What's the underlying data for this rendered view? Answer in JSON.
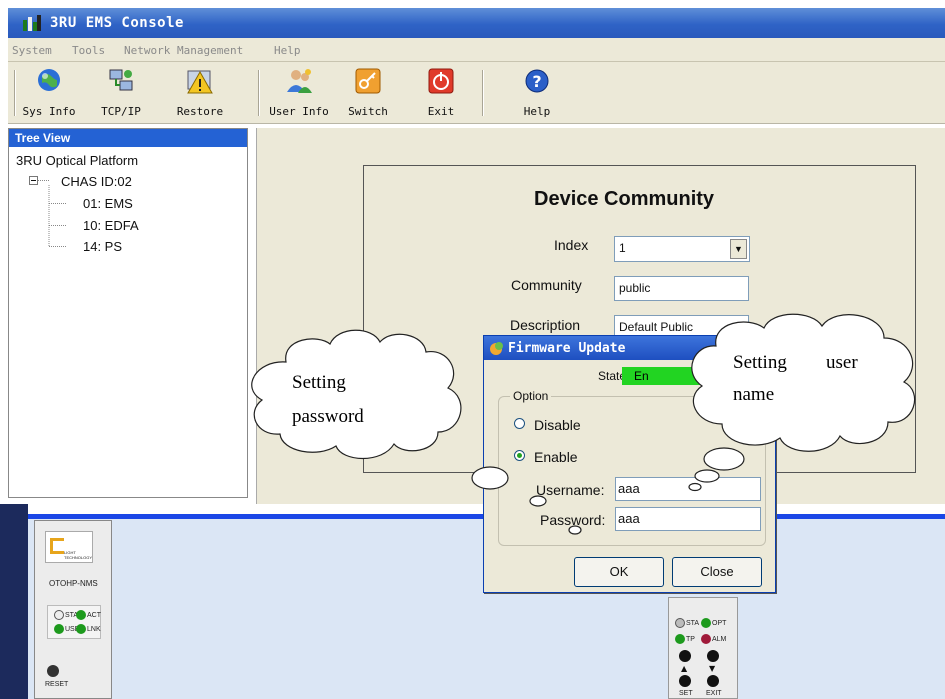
{
  "window": {
    "title": "3RU EMS Console"
  },
  "menu": [
    "System",
    "Tools",
    "Network Management",
    "Help"
  ],
  "toolbar": [
    {
      "label": "Sys Info",
      "icon": "globe-icon"
    },
    {
      "label": "TCP/IP",
      "icon": "network-icon"
    },
    {
      "label": "Restore",
      "icon": "warning-icon"
    },
    {
      "label": "User Info",
      "icon": "users-icon"
    },
    {
      "label": "Switch",
      "icon": "key-icon"
    },
    {
      "label": "Exit",
      "icon": "power-icon"
    },
    {
      "label": "Help",
      "icon": "help-icon"
    }
  ],
  "tree": {
    "header": "Tree View",
    "root": "3RU Optical Platform",
    "chassis": "CHAS ID:02",
    "items": [
      "01: EMS",
      "10: EDFA",
      "14: PS"
    ]
  },
  "community": {
    "title": "Device Community",
    "index_label": "Index",
    "index_value": "1",
    "community_label": "Community",
    "community_value": "public",
    "description_label": "Description",
    "description_value": "Default Public"
  },
  "dialog": {
    "title": "Firmware Update",
    "state_label": "State",
    "state_value": "En",
    "option_label": "Option",
    "disable_label": "Disable",
    "enable_label": "Enable",
    "username_label": "Username:",
    "username_value": "aaa",
    "password_label": "Password:",
    "password_value": "aaa",
    "ok_label": "OK",
    "close_label": "Close"
  },
  "callouts": {
    "password": [
      "Setting",
      "password"
    ],
    "username": [
      "Setting",
      "user",
      "name"
    ]
  },
  "card1": {
    "logo_text": "LIGHT TECHNOLOGY",
    "model": "OTOHP-NMS",
    "leds": [
      "STA",
      "ACT",
      "USB",
      "LNK"
    ],
    "reset": "RESET"
  },
  "card2": {
    "leds": [
      "STA",
      "OPT",
      "TP",
      "ALM"
    ],
    "set": "SET",
    "exit": "EXIT"
  },
  "colors": {
    "title_blue": "#2f63c6",
    "accent_blue": "#1a46e6",
    "state_green": "#22d422",
    "panel_bg": "#ece9d8"
  }
}
